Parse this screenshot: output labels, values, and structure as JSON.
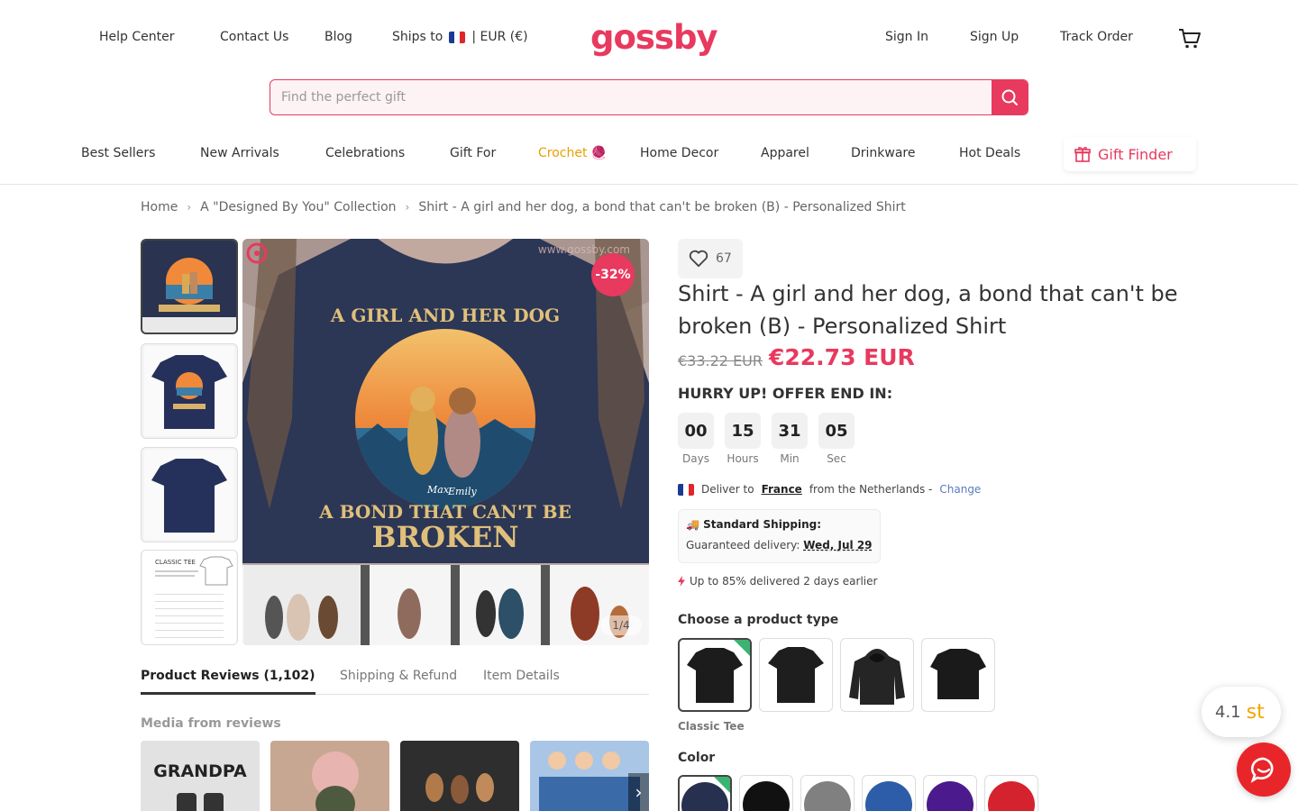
{
  "header": {
    "links_left": [
      "Help Center",
      "Contact Us",
      "Blog"
    ],
    "ships_to_label": "Ships to",
    "currency": "|  EUR (€)",
    "logo": "gossby",
    "links_right": [
      "Sign In",
      "Sign Up",
      "Track Order"
    ]
  },
  "search": {
    "placeholder": "Find the perfect gift"
  },
  "nav": {
    "items": [
      "Best Sellers",
      "New Arrivals",
      "Celebrations",
      "Gift For",
      "Crochet 🧶",
      "Home Decor",
      "Apparel",
      "Drinkware",
      "Hot Deals"
    ],
    "gift_finder": "Gift Finder"
  },
  "breadcrumb": [
    "Home",
    "A \"Designed By You\" Collection",
    "Shirt - A girl and her dog, a bond that can't be broken (B) - Personalized Shirt"
  ],
  "gallery": {
    "discount": "-32%",
    "counter": "1/4",
    "print_top": "A GIRL AND HER DOG",
    "print_bottom": "A BOND THAT CAN'T BE",
    "print_big": "BROKEN",
    "name_1": "Max",
    "name_2": "Emily",
    "watermark": "www.gossby.com",
    "size_chart_title": "CLASSIC TEE"
  },
  "tabs": [
    "Product Reviews (1,102)",
    "Shipping & Refund",
    "Item Details"
  ],
  "media_title": "Media from reviews",
  "media_text": "GRANDPA",
  "product": {
    "likes": "67",
    "title": "Shirt - A girl and her dog, a bond that can't be broken (B) - Personalized Shirt",
    "old_price": "€33.22 EUR",
    "new_price": "€22.73 EUR",
    "hurry": "HURRY UP! OFFER END IN:",
    "countdown": [
      {
        "value": "00",
        "label": "Days"
      },
      {
        "value": "15",
        "label": "Hours"
      },
      {
        "value": "31",
        "label": "Min"
      },
      {
        "value": "05",
        "label": "Sec"
      }
    ],
    "deliver_prefix": "Deliver to",
    "deliver_country": "France",
    "deliver_suffix": "from the Netherlands -",
    "change": "Change",
    "shipping_title": "🚚 Standard Shipping:",
    "guaranteed": "Guaranteed delivery:",
    "delivery_date": "Wed, Jul 29",
    "upto": "Up to 85% delivered 2 days earlier",
    "choose_type": "Choose a product type",
    "selected_type": "Classic Tee",
    "color_title": "Color",
    "swatch_colors": [
      "#27304f",
      "#111111",
      "#808080",
      "#2d5da8",
      "#4b1a8c",
      "#d4232f"
    ]
  },
  "floating": {
    "rating": "4.1",
    "rating_suffix": "st"
  },
  "colors": {
    "accent": "#e8395f",
    "navy": "#27304f"
  }
}
